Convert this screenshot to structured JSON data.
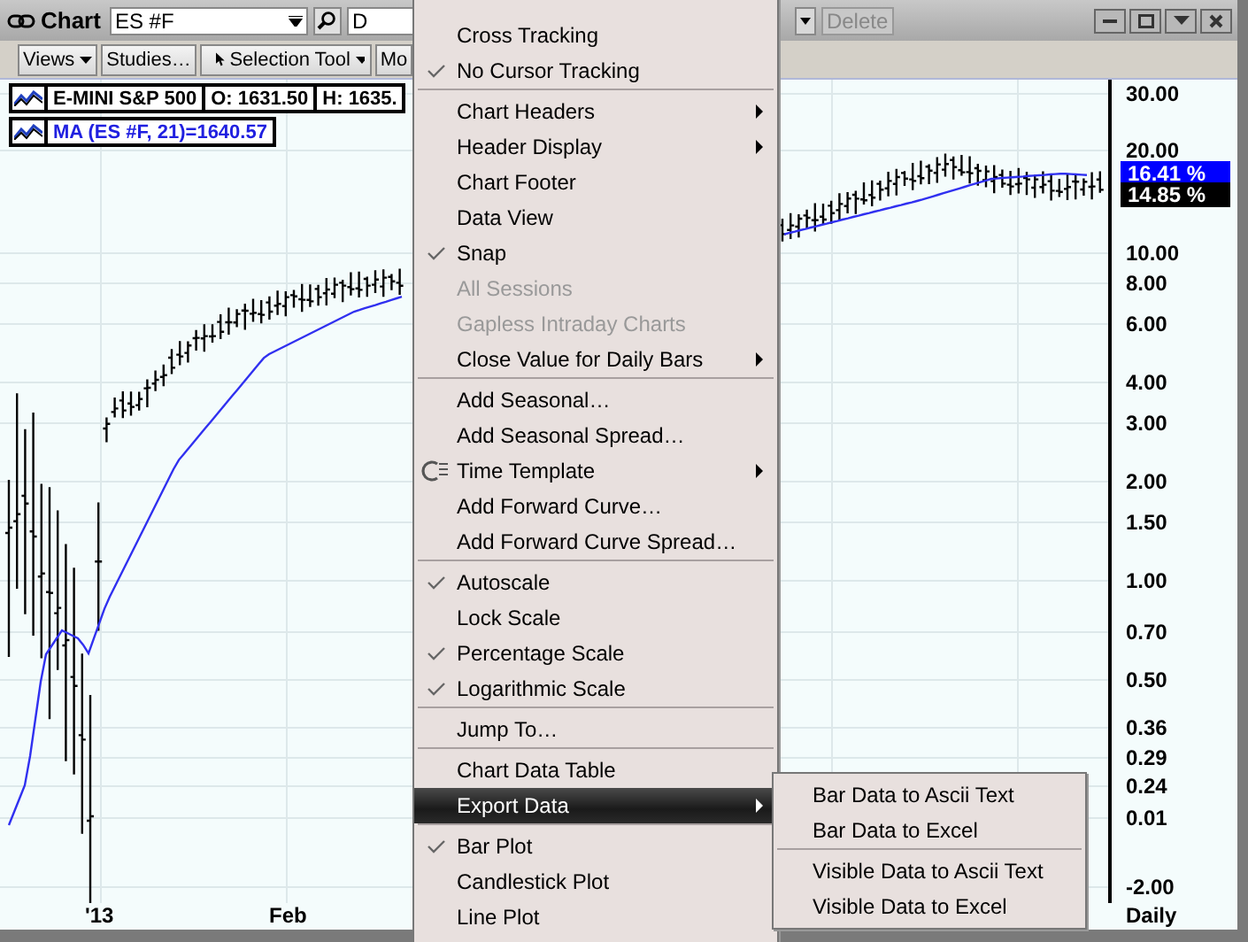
{
  "title_bar": {
    "title": "Chart",
    "symbol": "ES #F",
    "period": "D",
    "delete_button": {
      "label": "Delete",
      "disabled": true
    }
  },
  "toolbar": [
    {
      "label": "Views",
      "dropdown": true
    },
    {
      "label": "Studies…",
      "dropdown": false
    },
    {
      "label": "Selection Tool",
      "dropdown": true,
      "kind": "tool"
    },
    {
      "label": "Mo",
      "dropdown": false
    }
  ],
  "chart": {
    "header": [
      "E-MINI S&P 500",
      "O: 1631.50",
      "H: 1635."
    ],
    "study_label": "MA (ES #F, 21)=1640.57",
    "y_axis_labels": [
      "30.00",
      "20.00",
      "10.00",
      "8.00",
      "6.00",
      "4.00",
      "3.00",
      "2.00",
      "1.50",
      "1.00",
      "0.70",
      "0.50",
      "0.36",
      "0.29",
      "0.24",
      "0.01",
      "-2.00"
    ],
    "x_axis_labels": [
      "'13",
      "Feb"
    ],
    "interval": "Daily",
    "price_badges": [
      {
        "text": "16.41 %",
        "color": "#0000ff"
      },
      {
        "text": "14.85 %",
        "color": "#000000"
      }
    ]
  },
  "context_menu": {
    "items": [
      {
        "kind": "item",
        "label": "Cross Tracking",
        "checked": false,
        "disabled": false,
        "submenu": false,
        "selected": false
      },
      {
        "kind": "item",
        "label": "No Cursor Tracking",
        "checked": true,
        "disabled": false,
        "submenu": false,
        "selected": false
      },
      {
        "kind": "separator"
      },
      {
        "kind": "item",
        "label": "Chart Headers",
        "checked": false,
        "disabled": false,
        "submenu": true,
        "selected": false
      },
      {
        "kind": "item",
        "label": "Header Display",
        "checked": false,
        "disabled": false,
        "submenu": true,
        "selected": false
      },
      {
        "kind": "item",
        "label": "Chart Footer",
        "checked": false,
        "disabled": false,
        "submenu": false,
        "selected": false
      },
      {
        "kind": "item",
        "label": "Data View",
        "checked": false,
        "disabled": false,
        "submenu": false,
        "selected": false
      },
      {
        "kind": "item",
        "label": "Snap",
        "checked": true,
        "disabled": false,
        "submenu": false,
        "selected": false
      },
      {
        "kind": "item",
        "label": "All Sessions",
        "checked": false,
        "disabled": true,
        "submenu": false,
        "selected": false
      },
      {
        "kind": "item",
        "label": "Gapless Intraday Charts",
        "checked": false,
        "disabled": true,
        "submenu": false,
        "selected": false
      },
      {
        "kind": "item",
        "label": "Close Value for Daily Bars",
        "checked": false,
        "disabled": false,
        "submenu": true,
        "selected": false
      },
      {
        "kind": "separator"
      },
      {
        "kind": "item",
        "label": "Add Seasonal…",
        "checked": false,
        "disabled": false,
        "submenu": false,
        "selected": false
      },
      {
        "kind": "item",
        "label": "Add Seasonal Spread…",
        "checked": false,
        "disabled": false,
        "submenu": false,
        "selected": false
      },
      {
        "kind": "item",
        "label": "Time Template",
        "checked": false,
        "disabled": false,
        "submenu": true,
        "selected": false,
        "has_icon": true
      },
      {
        "kind": "item",
        "label": "Add Forward Curve…",
        "checked": false,
        "disabled": false,
        "submenu": false,
        "selected": false
      },
      {
        "kind": "item",
        "label": "Add Forward Curve Spread…",
        "checked": false,
        "disabled": false,
        "submenu": false,
        "selected": false
      },
      {
        "kind": "separator"
      },
      {
        "kind": "item",
        "label": "Autoscale",
        "checked": true,
        "disabled": false,
        "submenu": false,
        "selected": false
      },
      {
        "kind": "item",
        "label": "Lock Scale",
        "checked": false,
        "disabled": false,
        "submenu": false,
        "selected": false
      },
      {
        "kind": "item",
        "label": "Percentage Scale",
        "checked": true,
        "disabled": false,
        "submenu": false,
        "selected": false
      },
      {
        "kind": "item",
        "label": "Logarithmic Scale",
        "checked": true,
        "disabled": false,
        "submenu": false,
        "selected": false
      },
      {
        "kind": "separator"
      },
      {
        "kind": "item",
        "label": "Jump To…",
        "checked": false,
        "disabled": false,
        "submenu": false,
        "selected": false
      },
      {
        "kind": "separator"
      },
      {
        "kind": "item",
        "label": "Chart Data Table",
        "checked": false,
        "disabled": false,
        "submenu": false,
        "selected": false
      },
      {
        "kind": "item",
        "label": "Export Data",
        "checked": false,
        "disabled": false,
        "submenu": true,
        "selected": true
      },
      {
        "kind": "separator"
      },
      {
        "kind": "item",
        "label": "Bar Plot",
        "checked": true,
        "disabled": false,
        "submenu": false,
        "selected": false
      },
      {
        "kind": "item",
        "label": "Candlestick Plot",
        "checked": false,
        "disabled": false,
        "submenu": false,
        "selected": false
      },
      {
        "kind": "item",
        "label": "Line Plot",
        "checked": false,
        "disabled": false,
        "submenu": false,
        "selected": false
      }
    ]
  },
  "submenu": {
    "items": [
      {
        "kind": "item",
        "label": "Bar Data to Ascii Text",
        "selected": false
      },
      {
        "kind": "item",
        "label": "Bar Data to Excel",
        "selected": false
      },
      {
        "kind": "separator"
      },
      {
        "kind": "item",
        "label": "Visible Data to Ascii Text",
        "selected": false
      },
      {
        "kind": "item",
        "label": "Visible Data to Excel",
        "selected": false
      }
    ]
  }
}
